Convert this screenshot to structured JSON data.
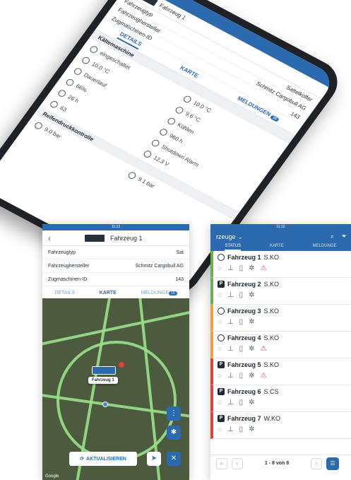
{
  "phone": {
    "title": "Fahrzeug 1",
    "rows": [
      {
        "label": "Fahrzeugtyp",
        "value": "Sattelkoffer"
      },
      {
        "label": "Fahrzeughersteller",
        "value": "Schmitz Cargobull AG"
      },
      {
        "label": "Zugmaschinen-ID",
        "value": "143"
      }
    ],
    "tabs": [
      "DETAILS",
      "KARTE",
      "MELDUNGEN"
    ],
    "tab_badge": "10",
    "section_1": "Kältemaschine",
    "grid": [
      [
        "eingeschaltet",
        "10.0 °C"
      ],
      [
        "10.0 °C",
        "9.6 °C"
      ],
      [
        "Dauerlauf",
        "Kühlen"
      ],
      [
        "66%",
        "960 h"
      ],
      [
        "26 h",
        "Shutdown Alarm"
      ],
      [
        "63",
        "12.3 V"
      ]
    ],
    "section_2": "Reifendruckkontrolle",
    "tires": [
      "9.0 bar",
      "9.1 bar"
    ]
  },
  "left": {
    "status_time": "11:12",
    "title": "Fahrzeug 1",
    "rows": [
      {
        "label": "Fahrzeugtyp",
        "value": "Sat"
      },
      {
        "label": "Fahrzeughersteller",
        "value": "Schmitz Cargobull AG"
      },
      {
        "label": "Zugmaschinen-ID",
        "value": "143"
      }
    ],
    "tabs": [
      "DETAILS",
      "KARTE",
      "MELDUNGE"
    ],
    "tab_badge": "10",
    "map_label": "Fahrzeug 1",
    "refresh": "AKTUALISIEREN",
    "google": "Google"
  },
  "right": {
    "status_time": "11:12",
    "title": "rzeuge",
    "tabs": [
      "STATUS",
      "KARTE",
      "MELDUNGE"
    ],
    "vehicles": [
      {
        "name": "Fahrzeug 1",
        "code": "S.KO",
        "kind": "nav",
        "color": "#6ab24d",
        "warn": true
      },
      {
        "name": "Fahrzeug 2",
        "code": "S.KO",
        "kind": "P",
        "color": "#6ab24d",
        "warn": false
      },
      {
        "name": "Fahrzeug 3",
        "code": "S.KO",
        "kind": "nav",
        "color": "#f0a03c",
        "warn": false
      },
      {
        "name": "Fahrzeug 4",
        "code": "S.KO",
        "kind": "nav",
        "color": "#f0a03c",
        "warn": true
      },
      {
        "name": "Fahrzeug 5",
        "code": "S.KO",
        "kind": "P",
        "color": "#e3413b",
        "warn": true
      },
      {
        "name": "Fahrzeug 6",
        "code": "S.CS",
        "kind": "P",
        "color": "#e3413b",
        "warn": false
      },
      {
        "name": "Fahrzeug 7",
        "code": "W.KO",
        "kind": "P",
        "color": "#e3413b",
        "warn": false
      }
    ],
    "pager": "1 - 8 von 8"
  }
}
